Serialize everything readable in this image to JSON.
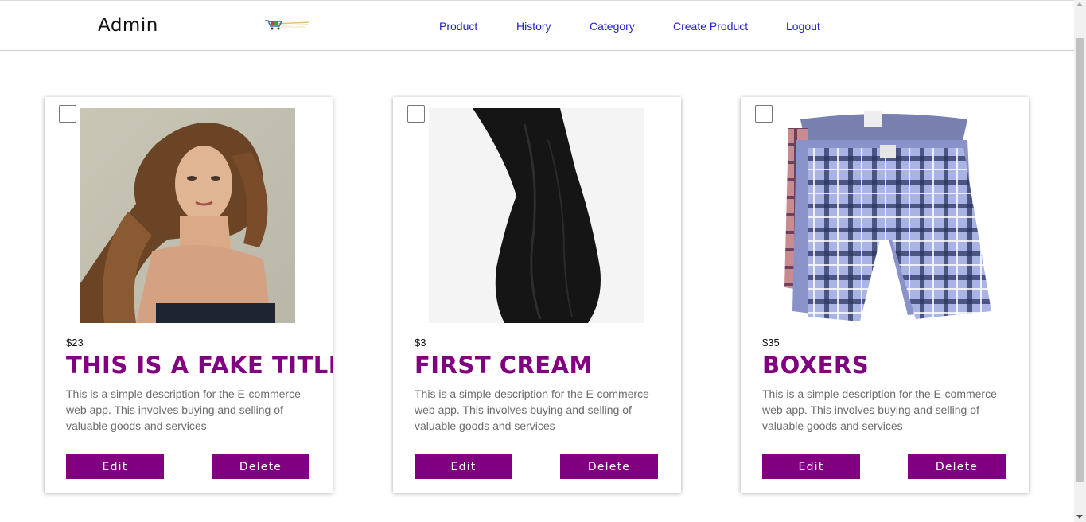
{
  "header": {
    "brand": "Admin",
    "nav": [
      "Product",
      "History",
      "Category",
      "Create Product",
      "Logout"
    ]
  },
  "products": [
    {
      "price": "$23",
      "title": "THIS IS A FAKE TITLE",
      "description": "This is a simple description for the E-commerce web app. This involves buying and selling of valuable goods and services",
      "edit_label": "Edit",
      "delete_label": "Delete"
    },
    {
      "price": "$3",
      "title": "FIRST CREAM",
      "description": "This is a simple description for the E-commerce web app. This involves buying and selling of valuable goods and services",
      "edit_label": "Edit",
      "delete_label": "Delete"
    },
    {
      "price": "$35",
      "title": "BOXERS",
      "description": "This is a simple description for the E-commerce web app. This involves buying and selling of valuable goods and services",
      "edit_label": "Edit",
      "delete_label": "Delete"
    }
  ],
  "colors": {
    "accent": "#800080",
    "nav_link": "#2222cc"
  }
}
